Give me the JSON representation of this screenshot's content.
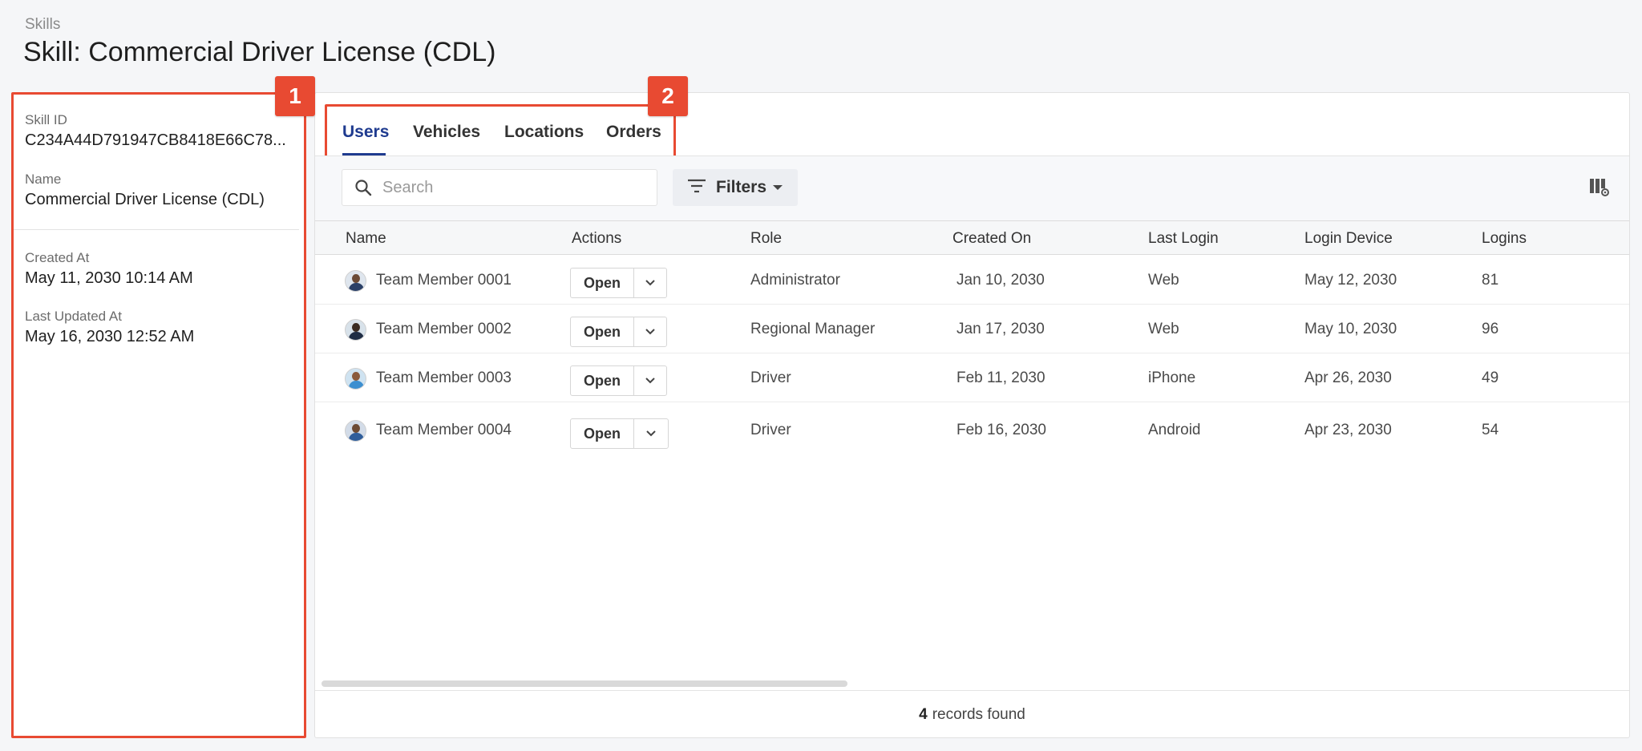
{
  "breadcrumb": "Skills",
  "page_title": "Skill: Commercial Driver License (CDL)",
  "details": {
    "skill_id_label": "Skill ID",
    "skill_id_value": "C234A44D791947CB8418E66C78...",
    "name_label": "Name",
    "name_value": "Commercial Driver License (CDL)",
    "created_label": "Created At",
    "created_value": "May 11, 2030 10:14 AM",
    "updated_label": "Last Updated At",
    "updated_value": "May 16, 2030 12:52 AM"
  },
  "badges": {
    "one": "1",
    "two": "2"
  },
  "tabs": [
    {
      "label": "Users",
      "active": true
    },
    {
      "label": "Vehicles",
      "active": false
    },
    {
      "label": "Locations",
      "active": false
    },
    {
      "label": "Orders",
      "active": false
    }
  ],
  "toolbar": {
    "search_placeholder": "Search",
    "filters_label": "Filters",
    "columns_icon": "column-settings-icon"
  },
  "table": {
    "columns": [
      "Name",
      "Actions",
      "Role",
      "Created On",
      "Last Login",
      "Login Device",
      "Logins"
    ],
    "rows": [
      {
        "name": "Team Member  0001",
        "action": "Open",
        "role": "Administrator",
        "created_on": "Jan 10, 2030",
        "last_login": "Web",
        "login_device": "May 12, 2030",
        "logins": "81"
      },
      {
        "name": "Team Member  0002",
        "action": "Open",
        "role": "Regional Manager",
        "created_on": "Jan 17, 2030",
        "last_login": "Web",
        "login_device": "May 10, 2030",
        "logins": "96"
      },
      {
        "name": "Team Member  0003",
        "action": "Open",
        "role": "Driver",
        "created_on": "Feb 11, 2030",
        "last_login": "iPhone",
        "login_device": "Apr 26, 2030",
        "logins": "49"
      },
      {
        "name": "Team Member  0004",
        "action": "Open",
        "role": "Driver",
        "created_on": "Feb 16, 2030",
        "last_login": "Android",
        "login_device": "Apr 23, 2030",
        "logins": "54"
      }
    ]
  },
  "footer": {
    "count": "4",
    "text": "records found"
  },
  "colors": {
    "accent_red": "#e84a32",
    "tab_active": "#1f3b8f"
  }
}
